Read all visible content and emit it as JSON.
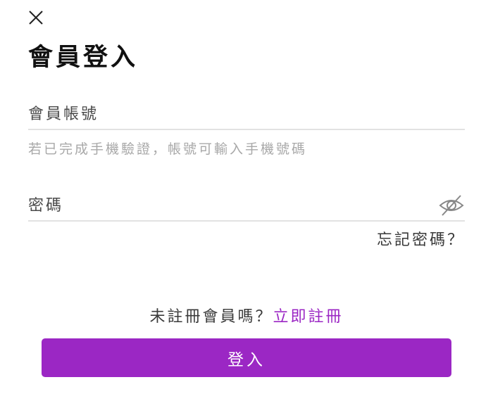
{
  "header": {
    "close_icon": "close-icon",
    "title": "會員登入"
  },
  "form": {
    "account": {
      "placeholder": "會員帳號",
      "value": "",
      "hint": "若已完成手機驗證，帳號可輸入手機號碼"
    },
    "password": {
      "placeholder": "密碼",
      "value": "",
      "toggle_icon": "eye-off-icon"
    },
    "forgot_password": "忘記密碼？"
  },
  "register": {
    "prompt": "未註冊會員嗎？",
    "link": "立即註冊"
  },
  "login_button": "登入",
  "colors": {
    "accent": "#9b27c4",
    "hint": "#a8a8a8",
    "divider": "#e2e2e2",
    "icon": "#888888"
  }
}
